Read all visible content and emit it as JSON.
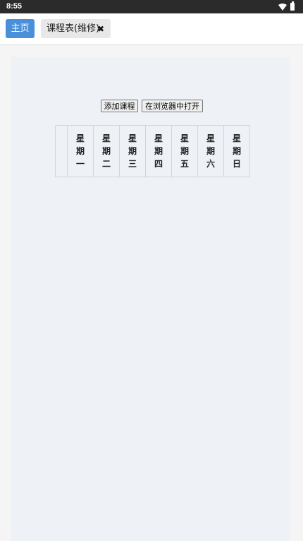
{
  "status_bar": {
    "time": "8:55"
  },
  "tabs": {
    "home_label": "主页",
    "schedule_label": "课程表(维修)",
    "close_glyph": "✖"
  },
  "toolbar": {
    "add_course_label": "添加课程",
    "open_in_browser_label": "在浏览器中打开"
  },
  "timetable": {
    "days": [
      "星期一",
      "星期二",
      "星期三",
      "星期四",
      "星期五",
      "星期六",
      "星期日"
    ]
  },
  "colors": {
    "accent": "#4a8fd9",
    "content_bg": "#eef2f7",
    "status_bar_bg": "#2b2b2b"
  }
}
